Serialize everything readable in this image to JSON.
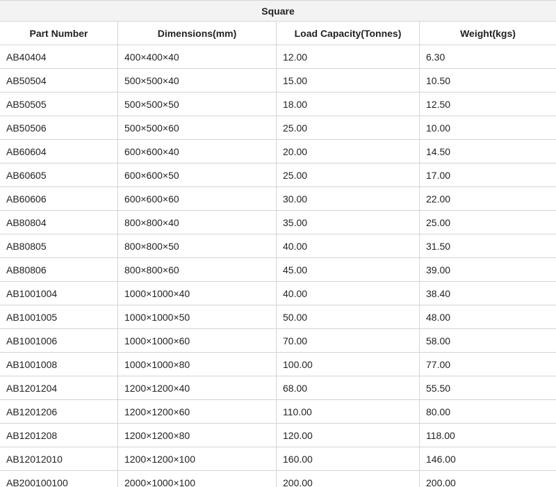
{
  "table": {
    "title": "Square",
    "headers": [
      "Part Number",
      "Dimensions(mm)",
      "Load Capacity(Tonnes)",
      "Weight(kgs)"
    ],
    "rows": [
      [
        "AB40404",
        "400×400×40",
        "12.00",
        "6.30"
      ],
      [
        "AB50504",
        "500×500×40",
        "15.00",
        "10.50"
      ],
      [
        "AB50505",
        "500×500×50",
        "18.00",
        "12.50"
      ],
      [
        "AB50506",
        "500×500×60",
        "25.00",
        "10.00"
      ],
      [
        "AB60604",
        "600×600×40",
        "20.00",
        "14.50"
      ],
      [
        "AB60605",
        "600×600×50",
        "25.00",
        "17.00"
      ],
      [
        "AB60606",
        "600×600×60",
        "30.00",
        "22.00"
      ],
      [
        "AB80804",
        "800×800×40",
        "35.00",
        "25.00"
      ],
      [
        "AB80805",
        "800×800×50",
        "40.00",
        "31.50"
      ],
      [
        "AB80806",
        "800×800×60",
        "45.00",
        "39.00"
      ],
      [
        "AB1001004",
        "1000×1000×40",
        "40.00",
        "38.40"
      ],
      [
        "AB1001005",
        "1000×1000×50",
        "50.00",
        "48.00"
      ],
      [
        "AB1001006",
        "1000×1000×60",
        "70.00",
        "58.00"
      ],
      [
        "AB1001008",
        "1000×1000×80",
        "100.00",
        "77.00"
      ],
      [
        "AB1201204",
        "1200×1200×40",
        "68.00",
        "55.50"
      ],
      [
        "AB1201206",
        "1200×1200×60",
        "110.00",
        "80.00"
      ],
      [
        "AB1201208",
        "1200×1200×80",
        "120.00",
        "118.00"
      ],
      [
        "AB12012010",
        "1200×1200×100",
        "160.00",
        "146.00"
      ],
      [
        "AB200100100",
        "2000×1000×100",
        "200.00",
        "200.00"
      ]
    ]
  }
}
